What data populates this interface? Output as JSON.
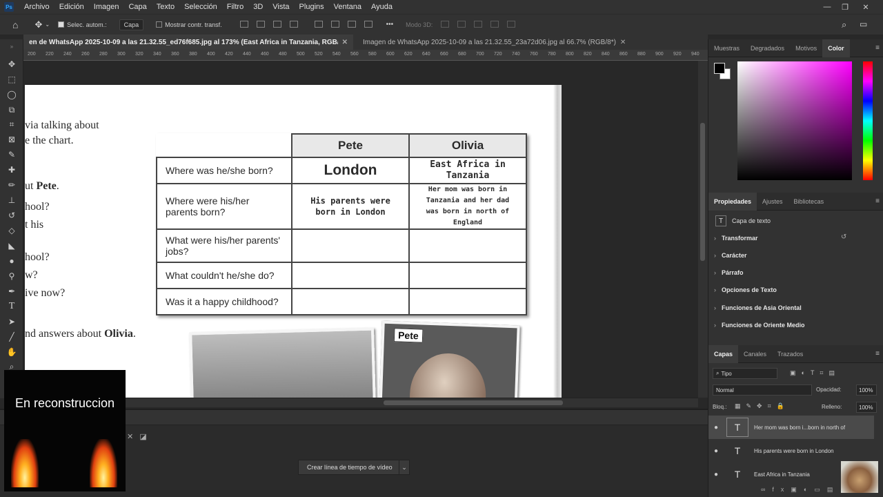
{
  "menubar": {
    "logo": "Ps",
    "items": [
      "Archivo",
      "Edición",
      "Imagen",
      "Capa",
      "Texto",
      "Selección",
      "Filtro",
      "3D",
      "Vista",
      "Plugins",
      "Ventana",
      "Ayuda"
    ],
    "minimize": "—",
    "restore": "❐",
    "close": "✕"
  },
  "options": {
    "auto_select_label": "Selec. autom.:",
    "auto_select_value": "Capa",
    "show_transform_label": "Mostrar contr. transf.",
    "mode_3d_label": "Modo 3D:",
    "more": "•••"
  },
  "tabs": [
    {
      "label": "en de WhatsApp 2025-10-09 a las 21.32.55_ed76f685.jpg al 173% (East Africa in  Tanzania, RGB/8*) *",
      "close": "✕"
    },
    {
      "label": "Imagen de WhatsApp 2025-10-09 a las 21.32.55_23a72d06.jpg al 66.7% (RGB/8*)",
      "close": "✕"
    }
  ],
  "ruler_ticks": [
    "200",
    "220",
    "240",
    "260",
    "280",
    "300",
    "320",
    "340",
    "360",
    "380",
    "400",
    "420",
    "440",
    "460",
    "480",
    "500",
    "520",
    "540",
    "560",
    "580",
    "600",
    "620",
    "640",
    "660",
    "680",
    "700",
    "720",
    "740",
    "760",
    "780",
    "800",
    "820",
    "840",
    "860",
    "880",
    "900",
    "920",
    "940"
  ],
  "document": {
    "left_lines": [
      "via talking about",
      "e the chart.",
      "ut Pete.",
      "hool?",
      "t his",
      "hool?",
      "w?",
      "ive now?",
      "nd answers about Olivia."
    ],
    "left_bold": {
      "pete": "Pete",
      "olivia": "Olivia"
    },
    "headers": [
      "Pete",
      "Olivia"
    ],
    "rows": [
      {
        "q": "Where was he/she born?",
        "pete": "London",
        "olivia": "East Africa in Tanzania"
      },
      {
        "q": "Where were his/her parents born?",
        "pete": "His parents were born in London",
        "olivia": "Her mom was born in Tanzania and her dad was born in north of England"
      },
      {
        "q": "What were his/her parents' jobs?",
        "pete": "",
        "olivia": ""
      },
      {
        "q": "What couldn't he/she do?",
        "pete": "",
        "olivia": ""
      },
      {
        "q": "Was it a happy childhood?",
        "pete": "",
        "olivia": ""
      }
    ],
    "photo_label": "Pete"
  },
  "timeline": {
    "create_button": "Crear línea de tiempo de vídeo",
    "dropdown": "⌄"
  },
  "overlay": {
    "text": "En reconstruccion"
  },
  "panel_color": {
    "tabs": [
      "Muestras",
      "Degradados",
      "Motivos",
      "Color"
    ],
    "active": "Color",
    "picker_hue": "#ff00ff"
  },
  "panel_props": {
    "tabs": [
      "Propiedades",
      "Ajustes",
      "Bibliotecas"
    ],
    "layer_kind": "Capa de texto",
    "sections": [
      "Transformar",
      "Carácter",
      "Párrafo",
      "Opciones de Texto",
      "Funciones de Asia Oriental",
      "Funciones de Oriente Medio"
    ]
  },
  "panel_layers": {
    "tabs": [
      "Capas",
      "Canales",
      "Trazados"
    ],
    "filter": "Tipo",
    "blend": "Normal",
    "opacity_label": "Opacidad:",
    "opacity_value": "100%",
    "lock_label": "Bloq.:",
    "fill_label": "Relleno:",
    "fill_value": "100%",
    "layers": [
      {
        "name": "Her mom was born i...born in north of",
        "selected": true
      },
      {
        "name": "His parents were  born in London",
        "selected": false
      },
      {
        "name": "East Africa in  Tanzania",
        "selected": false
      }
    ]
  }
}
